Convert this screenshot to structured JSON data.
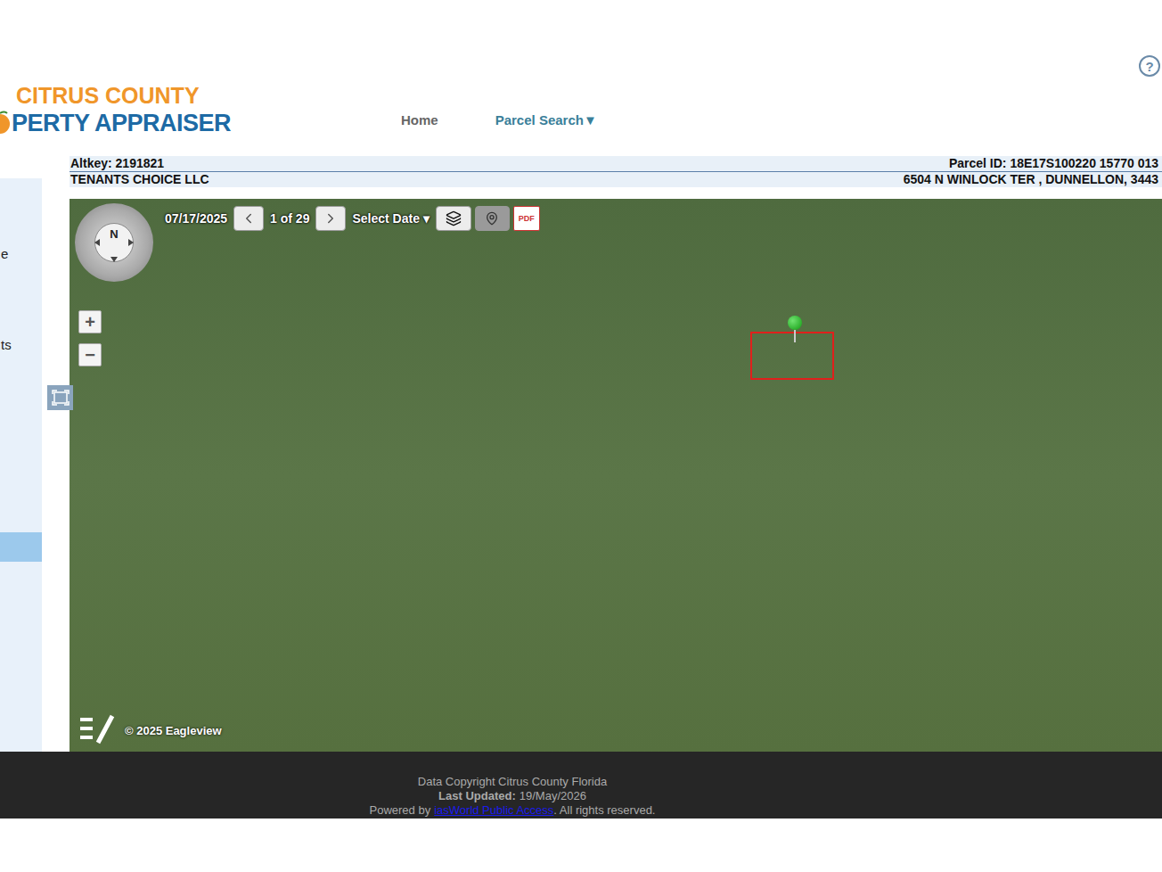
{
  "logo": {
    "line1": "CITRUS COUNTY",
    "line2": "PERTY APPRAISER"
  },
  "nav": [
    {
      "label": "Home"
    },
    {
      "label": "Parcel Search▼"
    }
  ],
  "help": "?",
  "sidebar": {
    "items": [
      {
        "label": "e",
        "selected": false
      },
      {
        "label": "ts",
        "selected": false
      },
      {
        "label": "",
        "selected": true
      }
    ]
  },
  "parcel": {
    "altkey": "Altkey: 2191821",
    "parcel_id": "Parcel ID: 18E17S100220 15770 013",
    "owner": "TENANTS CHOICE LLC",
    "address": "6504 N WINLOCK TER , DUNNELLON, 3443"
  },
  "map": {
    "date": "07/17/2025",
    "counter": "1 of 29",
    "select_date": "Select Date ▾",
    "compass": "N",
    "zoom_in": "+",
    "zoom_out": "−",
    "pdf": "PDF",
    "copyright": "© 2025 Eagleview"
  },
  "footer": {
    "copyright": "Data Copyright Citrus County Florida",
    "updated_label": "Last Updated:",
    "updated_value": "19/May/2026",
    "powered_by": "Powered by",
    "link": "iasWorld Public Access",
    "suffix": ". All rights reserved."
  }
}
